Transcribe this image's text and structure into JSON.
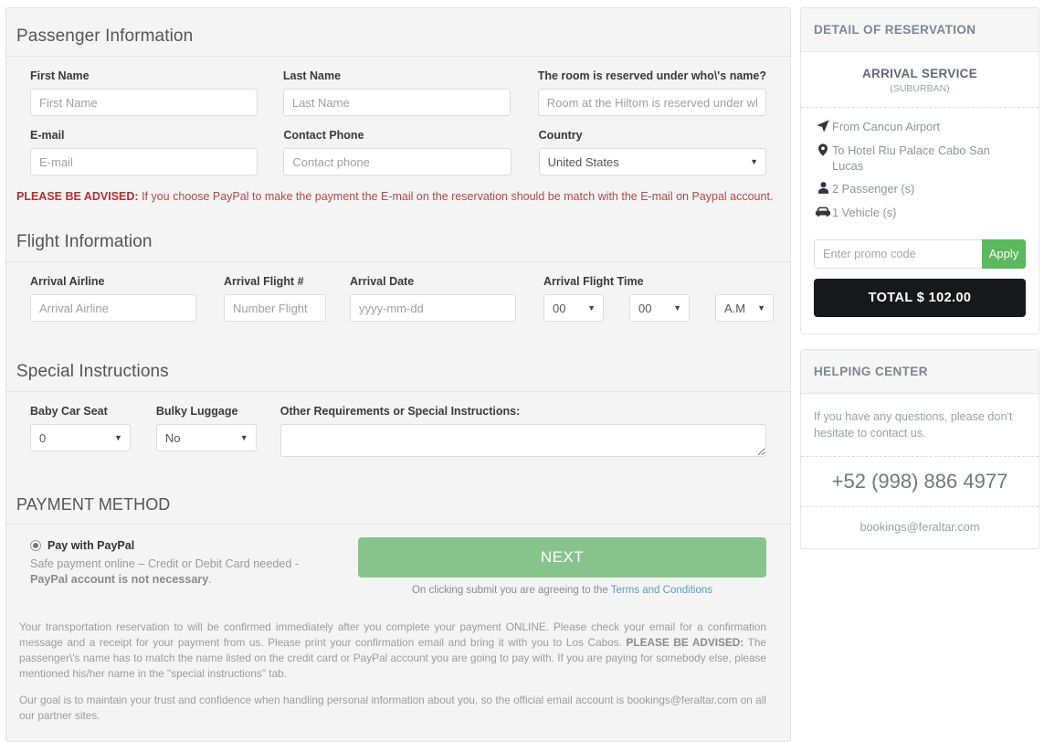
{
  "passenger": {
    "title": "Passenger Information",
    "first_name_label": "First Name",
    "first_name_placeholder": "First Name",
    "last_name_label": "Last Name",
    "last_name_placeholder": "Last Name",
    "room_label": "The room is reserved under who\\'s name?",
    "room_placeholder": "Room at the Hiltom is reserved under who\\'s name?",
    "email_label": "E-mail",
    "email_placeholder": "E-mail",
    "phone_label": "Contact Phone",
    "phone_placeholder": "Contact phone",
    "country_label": "Country",
    "country_value": "United States",
    "advice_bold": "PLEASE BE ADVISED:",
    "advice_text": " If you choose PayPal to make the payment the E-mail on the reservation should be match with the E-mail on Paypal account."
  },
  "flight": {
    "title": "Flight Information",
    "airline_label": "Arrival Airline",
    "airline_placeholder": "Arrival Airline",
    "flight_no_label": "Arrival Flight #",
    "flight_no_placeholder": "Number Flight",
    "date_label": "Arrival Date",
    "date_placeholder": "yyyy-mm-dd",
    "time_label": "Arrival Flight Time",
    "hour_value": "00",
    "minute_value": "00",
    "meridiem_value": "A.M"
  },
  "special": {
    "title": "Special Instructions",
    "baby_seat_label": "Baby Car Seat",
    "baby_seat_value": "0",
    "bulky_label": "Bulky Luggage",
    "bulky_value": "No",
    "other_label": "Other Requirements or Special Instructions:",
    "other_value": ""
  },
  "payment": {
    "title": "PAYMENT METHOD",
    "option_label": "Pay with PayPal",
    "note_plain": "Safe payment online – Credit or Debit Card needed - ",
    "note_bold": "PayPal account is not necessary",
    "note_end": ".",
    "next_label": "NEXT",
    "terms_prefix": "On clicking submit you are agreeing to the ",
    "terms_link": "Terms and Conditions"
  },
  "footnote": {
    "p1_a": "Your transportation reservation to will be confirmed immediately after you complete your payment ONLINE. Please check your email for a confirmation message and a receipt for your payment from us. Please print your confirmation email and bring it with you to Los Cabos. ",
    "p1_b": "PLEASE BE ADVISED:",
    "p1_c": " The passenger\\'s name has to match the name listed on the credit card or PayPal account you are going to pay with. If you are paying for somebody else, please mentioned his/her name in the \"special instructions\" tab.",
    "p2": "Our goal is to maintain your trust and confidence when handling personal information about you, so the official email account is bookings@feraltar.com on all our partner sites."
  },
  "reservation": {
    "head": "DETAIL OF RESERVATION",
    "service_name": "ARRIVAL SERVICE",
    "service_sub": "(SUBURBAN)",
    "rows": [
      {
        "icon": "location-arrow-icon",
        "text": "From Cancun Airport"
      },
      {
        "icon": "map-marker-icon",
        "text": "To Hotel Riu Palace Cabo San Lucas"
      },
      {
        "icon": "person-icon",
        "text": "2 Passenger (s)"
      },
      {
        "icon": "car-icon",
        "text": "1 Vehicle (s)"
      }
    ],
    "promo_placeholder": "Enter promo code",
    "promo_value": "",
    "apply_label": "Apply",
    "total_label": "TOTAL $ 102.00"
  },
  "help": {
    "head": "HELPING CENTER",
    "text": "If you have any questions, please don't hesitate to contact us.",
    "phone": "+52 (998) 886 4977",
    "email": "bookings@feraltar.com"
  },
  "colors": {
    "accent_green": "#86c48b",
    "apply_green": "#5cb85c",
    "total_black": "#16181a",
    "advice_red": "#b04a4a",
    "link_blue": "#5b9bbd"
  }
}
